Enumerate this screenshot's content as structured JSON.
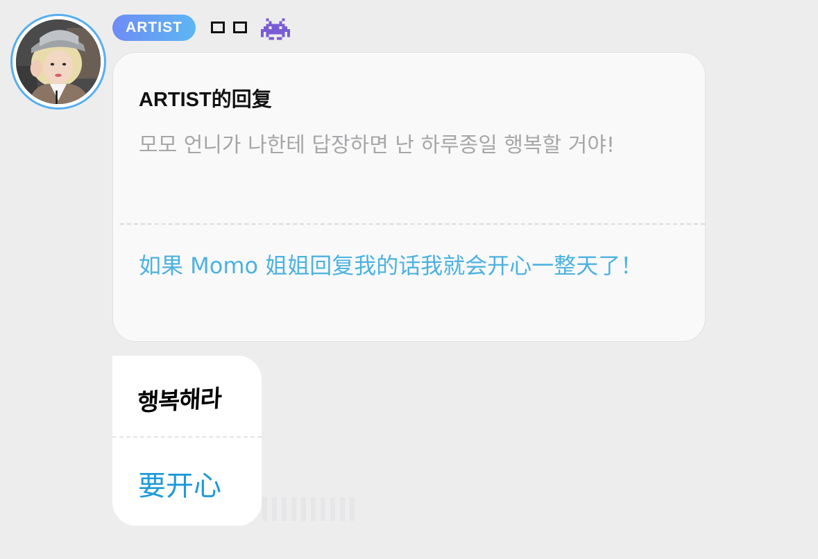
{
  "header": {
    "badge_label": "ARTIST",
    "username": "□□",
    "username_icon": "alien-monster-icon"
  },
  "reply_card": {
    "title": "ARTIST的回复",
    "original_text": "모모 언니가 나한테 답장하면 난 하루종일 행복할 거야!",
    "translated_text": "如果 Momo 姐姐回复我的话我就会开心一整天了！"
  },
  "response_card": {
    "original_text": "행복해라",
    "translated_text": "要开心"
  },
  "colors": {
    "background": "#ededed",
    "badge_gradient_start": "#6e8cf6",
    "badge_gradient_end": "#5db6f2",
    "translation_blue": "#4cb2e0",
    "avatar_ring": "#54aef0"
  }
}
